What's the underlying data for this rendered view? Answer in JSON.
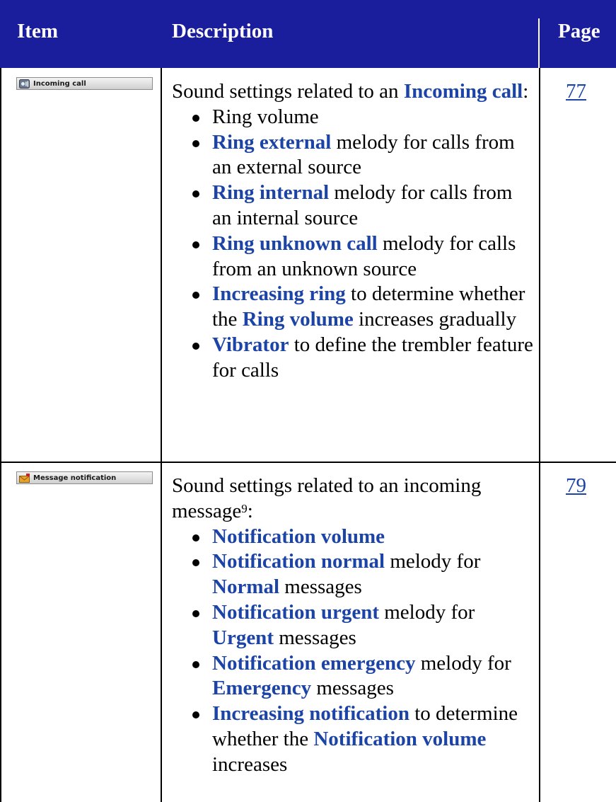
{
  "header": {
    "item": "Item",
    "description": "Description",
    "page": "Page"
  },
  "colors": {
    "header_bg": "#1a1d9c",
    "keyword": "#1c44a7"
  },
  "rows": [
    {
      "icon_name": "phone-speaker-icon",
      "item_label": "Incoming call",
      "intro": {
        "pre": "Sound settings related to an ",
        "kw": "Incoming call",
        "post": ":"
      },
      "bullets": [
        {
          "text": "Ring volume"
        },
        {
          "kw": "Ring external",
          "text": " melody for calls from an external source"
        },
        {
          "kw": "Ring internal",
          "text": " melody for calls from an internal source"
        },
        {
          "kw": "Ring unknown call",
          "text": " melody for calls from an unknown source"
        },
        {
          "kw": "Increasing ring",
          "text": "  to determine whether the ",
          "kw2": "Ring volume",
          "text2": " increases gradually"
        },
        {
          "kw": "Vibrator",
          "text": " to define the trembler feature for calls"
        }
      ],
      "page": "77"
    },
    {
      "icon_name": "envelope-notification-icon",
      "item_label": "Message notification",
      "intro": {
        "pre": "Sound settings related to an incoming message",
        "sup": "9",
        "post": ":"
      },
      "bullets": [
        {
          "kw": "Notification volume"
        },
        {
          "kw": "Notification normal",
          "text": " melody for ",
          "kw2": "Normal",
          "text2": " messages"
        },
        {
          "kw": "Notification urgent",
          "text": " melody for ",
          "kw2": "Urgent",
          "text2": " messages"
        },
        {
          "kw": "Notification emergency",
          "text": " melody for ",
          "kw2": "Emergency",
          "text2": " messages"
        },
        {
          "kw": "Increasing notification",
          "text": "  to determine whether the ",
          "kw2": "Notification volume",
          "text2": " increases"
        }
      ],
      "page": "79"
    }
  ]
}
